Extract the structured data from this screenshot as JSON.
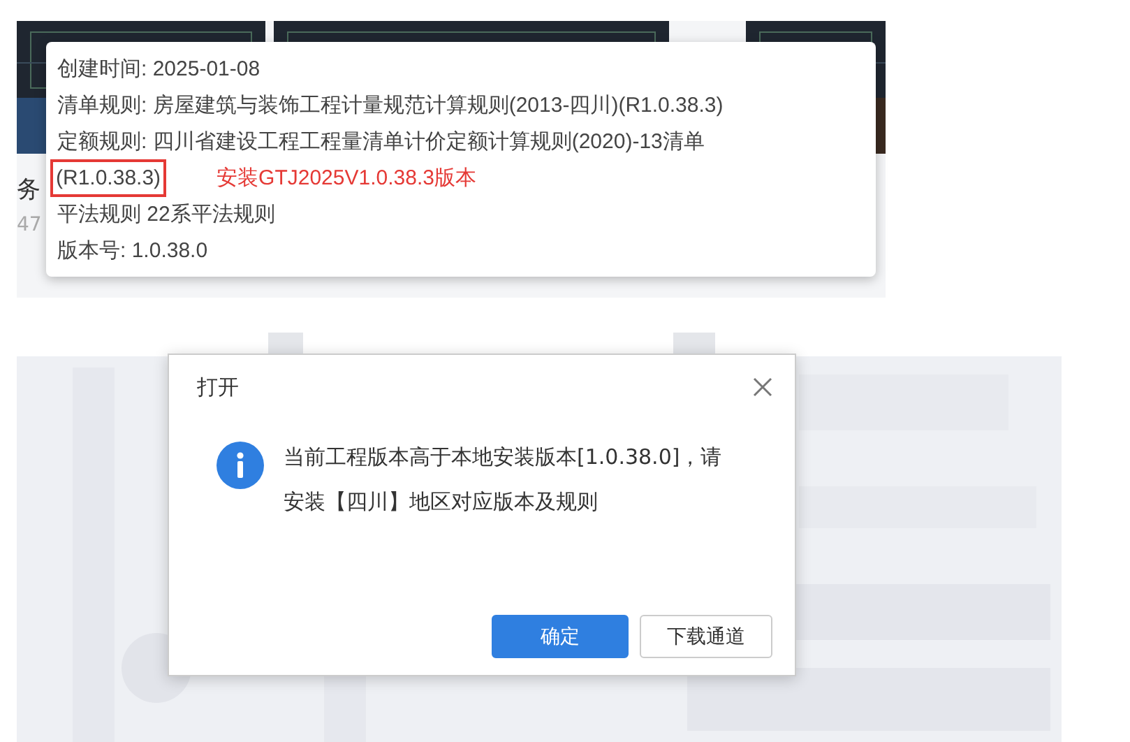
{
  "cards": [
    {
      "title": "务",
      "meta": "47"
    }
  ],
  "tooltip": {
    "lines": [
      {
        "label": "创建时间:",
        "value": "2025-01-08"
      },
      {
        "label": "清单规则:",
        "value": "房屋建筑与装饰工程计量规范计算规则(2013-四川)(R1.0.38.3)"
      },
      {
        "label": "定额规则:",
        "value": "四川省建设工程工程量清单计价定额计算规则(2020)-13清单"
      },
      {
        "value": "(R1.0.38.3)",
        "highlighted": true,
        "note": "安装GTJ2025V1.0.38.3版本"
      },
      {
        "label": "平法规则",
        "value": "22系平法规则"
      },
      {
        "label": "版本号:",
        "value": "1.0.38.0"
      }
    ]
  },
  "dialog": {
    "title": "打开",
    "message": "当前工程版本高于本地安装版本[1.0.38.0]，请安装【四川】地区对应版本及规则",
    "buttons": [
      {
        "label": "确定",
        "primary": true
      },
      {
        "label": "下载通道",
        "primary": false
      }
    ]
  }
}
